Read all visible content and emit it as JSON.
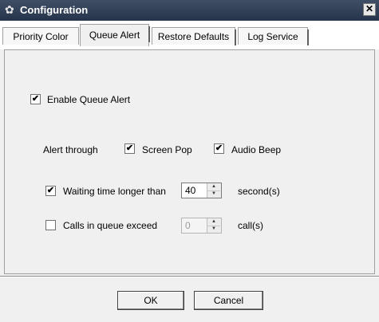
{
  "window": {
    "title": "Configuration",
    "close_symbol": "✕",
    "title_icon": "gear-icon"
  },
  "tabs": [
    {
      "label": "Priority Color",
      "active": false
    },
    {
      "label": "Queue Alert",
      "active": true
    },
    {
      "label": "Restore Defaults",
      "active": false
    },
    {
      "label": "Log Service",
      "active": false
    }
  ],
  "queue_alert": {
    "enable": {
      "label": "Enable Queue Alert",
      "checked": true
    },
    "alert_through_label": "Alert through",
    "screen_pop": {
      "label": "Screen Pop",
      "checked": true
    },
    "audio_beep": {
      "label": "Audio Beep",
      "checked": true
    },
    "waiting_time": {
      "label": "Waiting time longer than",
      "checked": true,
      "value": "40",
      "unit": "second(s)"
    },
    "calls_in_queue": {
      "label": "Calls in queue exceed",
      "checked": false,
      "value": "0",
      "unit": "call(s)",
      "enabled": false
    }
  },
  "buttons": {
    "ok": "OK",
    "cancel": "Cancel"
  },
  "colors": {
    "titlebar": "#26344a",
    "panel": "#f0f0f0"
  }
}
